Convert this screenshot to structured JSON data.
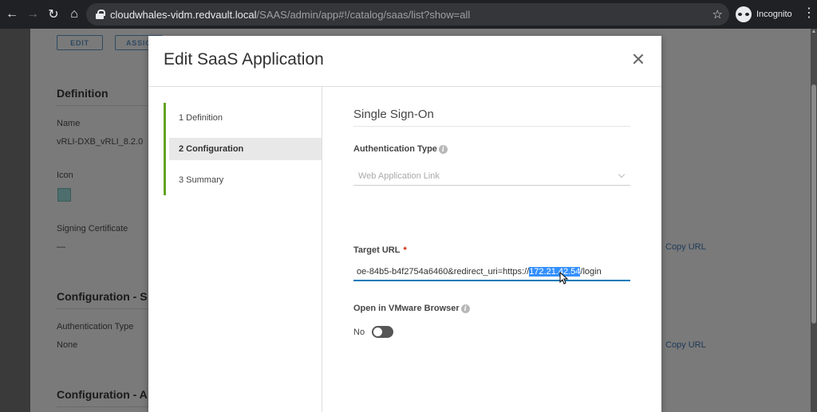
{
  "browser": {
    "url_host": "cloudwhales-vidm.redvault.local",
    "url_path": "/SAAS/admin/app#!/catalog/saas/list?show=all",
    "profile_label": "Incognito"
  },
  "background": {
    "buttons": [
      "EDIT",
      "ASSIG"
    ],
    "definition_heading": "Definition",
    "name_label": "Name",
    "name_value": "vRLI-DXB_vRLI_8.2.0",
    "icon_label": "Icon",
    "signing_cert_label": "Signing Certificate",
    "signing_cert_value": "—",
    "config_heading_1": "Configuration - S",
    "auth_type_label": "Authentication Type",
    "auth_type_value": "None",
    "config_heading_2": "Configuration - A",
    "copy_url_1": "Copy URL",
    "copy_url_2": "Copy URL"
  },
  "modal": {
    "title": "Edit SaaS Application",
    "steps": [
      {
        "label": "1  Definition",
        "active": false
      },
      {
        "label": "2  Configuration",
        "active": true
      },
      {
        "label": "3  Summary",
        "active": false
      }
    ],
    "section_heading": "Single Sign-On",
    "auth_type": {
      "label": "Authentication Type",
      "value": "Web Application Link"
    },
    "target_url": {
      "label": "Target URL",
      "required_mark": "*",
      "value_before": "oe-84b5-b4f2754a6460&redirect_uri=https://",
      "value_selected": "172.21.42.54",
      "value_after": "/login"
    },
    "open_in_browser": {
      "label": "Open in VMware Browser",
      "state_text": "No"
    }
  },
  "colors": {
    "accent": "#0079b8",
    "step_bar": "#62a420",
    "required": "#c92100",
    "selection": "#3390ff"
  }
}
